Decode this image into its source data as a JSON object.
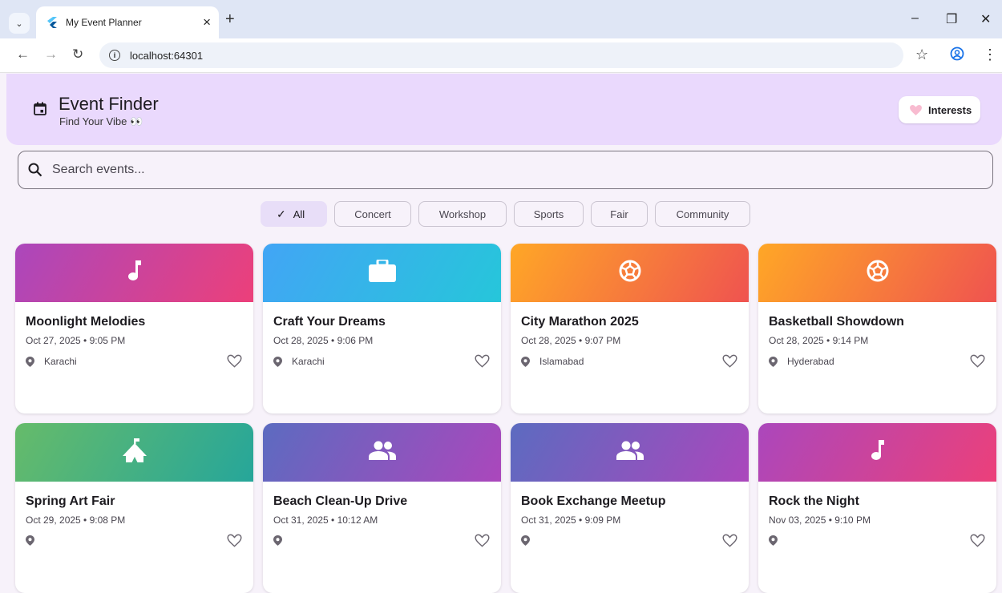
{
  "browser": {
    "tab_title": "My Event Planner",
    "tab_close": "×",
    "new_tab": "+",
    "url": "localhost:64301",
    "window": {
      "minimize": "–",
      "restore": "❐",
      "close": "✕"
    }
  },
  "header": {
    "title": "Event Finder",
    "subtitle": "Find Your Vibe 👀",
    "interests_label": "Interests"
  },
  "search": {
    "placeholder": "Search events..."
  },
  "filters": [
    {
      "label": "All",
      "selected": true
    },
    {
      "label": "Concert",
      "selected": false
    },
    {
      "label": "Workshop",
      "selected": false
    },
    {
      "label": "Sports",
      "selected": false
    },
    {
      "label": "Fair",
      "selected": false
    },
    {
      "label": "Community",
      "selected": false
    }
  ],
  "events": [
    {
      "name": "Moonlight Melodies",
      "date": "Oct 27, 2025 • 9:05 PM",
      "location": "Karachi",
      "icon": "music-note-icon",
      "gradient": [
        "#ab47bc",
        "#ec407a"
      ]
    },
    {
      "name": "Craft Your Dreams",
      "date": "Oct 28, 2025 • 9:06 PM",
      "location": "Karachi",
      "icon": "briefcase-icon",
      "gradient": [
        "#42a5f5",
        "#26c6da"
      ]
    },
    {
      "name": "City Marathon 2025",
      "date": "Oct 28, 2025 • 9:07 PM",
      "location": "Islamabad",
      "icon": "soccer-ball-icon",
      "gradient": [
        "#ffa726",
        "#ef5350"
      ]
    },
    {
      "name": "Basketball Showdown",
      "date": "Oct 28, 2025 • 9:14 PM",
      "location": "Hyderabad",
      "icon": "soccer-ball-icon",
      "gradient": [
        "#ffa726",
        "#ef5350"
      ]
    },
    {
      "name": "Spring Art Fair",
      "date": "Oct 29, 2025 • 9:08 PM",
      "location": "",
      "icon": "fair-tent-icon",
      "gradient": [
        "#66bb6a",
        "#26a69a"
      ]
    },
    {
      "name": "Beach Clean-Up Drive",
      "date": "Oct 31, 2025 • 10:12 AM",
      "location": "",
      "icon": "people-icon",
      "gradient": [
        "#5c6bc0",
        "#ab47bc"
      ]
    },
    {
      "name": "Book Exchange Meetup",
      "date": "Oct 31, 2025 • 9:09 PM",
      "location": "",
      "icon": "people-icon",
      "gradient": [
        "#5c6bc0",
        "#ab47bc"
      ]
    },
    {
      "name": "Rock the Night",
      "date": "Nov 03, 2025 • 9:10 PM",
      "location": "",
      "icon": "music-note-icon",
      "gradient": [
        "#ab47bc",
        "#ec407a"
      ]
    }
  ]
}
